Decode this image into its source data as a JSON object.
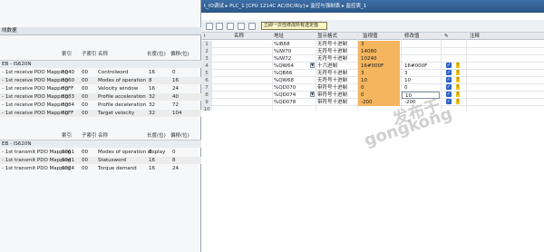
{
  "left_panel": {
    "title": "线数据",
    "columns": [
      "索引",
      "子索引",
      "名称",
      "长度(位)",
      "偏移(位)"
    ],
    "rx_group_label": "EB - IS620N",
    "rx_rows": [
      {
        "mapping": "- 1st receive PDO Mapping",
        "index": "6040",
        "sub": "00",
        "name": "Controlword",
        "len": "16",
        "off": "0"
      },
      {
        "mapping": "- 1st receive PDO Mapping",
        "index": "6060",
        "sub": "00",
        "name": "Modes of operation",
        "len": "8",
        "off": "16"
      },
      {
        "mapping": "- 1st receive PDO Mapping",
        "index": "60FF",
        "sub": "00",
        "name": "Velocity window",
        "len": "16",
        "off": "24"
      },
      {
        "mapping": "- 1st receive PDO Mapping",
        "index": "6083",
        "sub": "00",
        "name": "Profile acceleration",
        "len": "32",
        "off": "40"
      },
      {
        "mapping": "- 1st receive PDO Mapping",
        "index": "6084",
        "sub": "00",
        "name": "Profile deceleration",
        "len": "32",
        "off": "72"
      },
      {
        "mapping": "- 1st receive PDO Mapping",
        "index": "60FF",
        "sub": "00",
        "name": "Target velocity",
        "len": "32",
        "off": "104"
      }
    ],
    "tx_group_label": "EB - IS620N",
    "tx_rows": [
      {
        "mapping": "- 1st transmit PDO Mapping",
        "index": "6061",
        "sub": "00",
        "name": "Modes of operation display",
        "len": "8",
        "off": "0"
      },
      {
        "mapping": "- 1st transmit PDO Mapping",
        "index": "6041",
        "sub": "00",
        "name": "Statusword",
        "len": "16",
        "off": "8"
      },
      {
        "mapping": "- 1st transmit PDO Mapping",
        "index": "6074",
        "sub": "00",
        "name": "Torque demand",
        "len": "16",
        "off": "24"
      }
    ]
  },
  "window": {
    "title": "t_IO调试 ▸ PLC_1 [CPU 1214C AC/DC/Rly] ▸ 监控与强制表 ▸ 监控表_1",
    "tooltip": "立即一次性修改所有选定值"
  },
  "grid": {
    "columns": [
      "i",
      "名称",
      "地址",
      "显示格式",
      "监视值",
      "修改值",
      "",
      "注释"
    ],
    "rows": [
      {
        "n": "1",
        "addr": "%IB68",
        "fmt": "无符号十进制",
        "monitor": "3",
        "modify": "",
        "chk": false,
        "warn": false
      },
      {
        "n": "2",
        "addr": "%IW70",
        "fmt": "无符号十进制",
        "monitor": "14080",
        "modify": "",
        "chk": false,
        "warn": false
      },
      {
        "n": "3",
        "addr": "%IW72",
        "fmt": "无符号十进制",
        "monitor": "10240",
        "modify": "",
        "chk": false,
        "warn": false
      },
      {
        "n": "4",
        "addr": "%QW64",
        "fmt": "十六进制",
        "monitor": "16#000F",
        "modify": "16#000F",
        "chk": true,
        "warn": true
      },
      {
        "n": "5",
        "addr": "%QB66",
        "fmt": "无符号十进制",
        "monitor": "3",
        "modify": "3",
        "chk": true,
        "warn": true
      },
      {
        "n": "6",
        "addr": "%QW68",
        "fmt": "无符号十进制",
        "monitor": "10",
        "modify": "10",
        "chk": true,
        "warn": true
      },
      {
        "n": "7",
        "addr": "%QD070",
        "fmt": "带符号十进制",
        "monitor": "0",
        "modify": "0",
        "chk": true,
        "warn": true
      },
      {
        "n": "8",
        "addr": "%QD074",
        "fmt": "带符号十进制",
        "monitor": "0",
        "modify": "10",
        "chk": true,
        "warn": true
      },
      {
        "n": "9",
        "addr": "%QD078",
        "fmt": "带符号十进制",
        "monitor": "-200",
        "modify": "-200",
        "chk": true,
        "warn": true
      },
      {
        "n": "10",
        "addr": "",
        "fmt": "",
        "monitor": "",
        "modify": "",
        "chk": false,
        "warn": false
      }
    ]
  },
  "watermark": {
    "line1": "发布于",
    "line2": "gongkong"
  },
  "colors": {
    "monitor_cell": "#f5b55f",
    "checkbox": "#2c62c4",
    "warning": "#f5c21a",
    "titlebar": "#2b5687"
  }
}
